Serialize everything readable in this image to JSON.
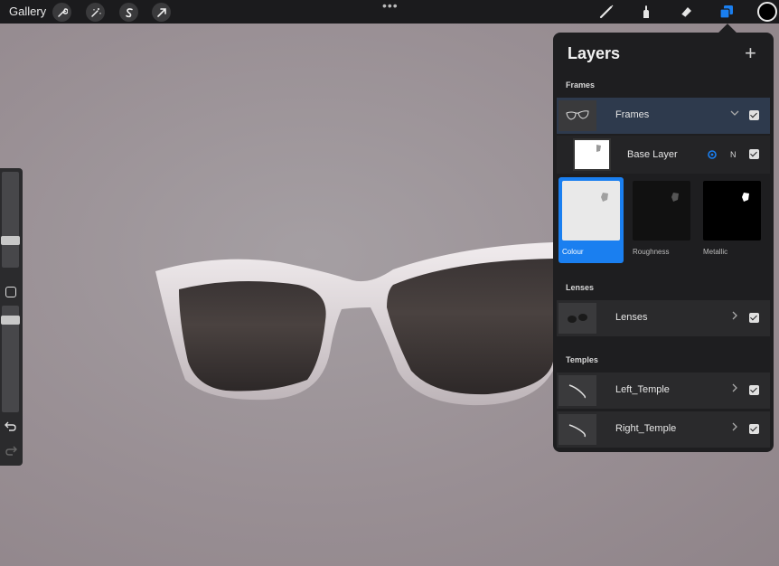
{
  "toolbar": {
    "gallery_label": "Gallery",
    "more_dots": "•••",
    "color_well": "#000000",
    "accent": "#1a7ff0"
  },
  "layers_panel": {
    "title": "Layers",
    "add_symbol": "+",
    "groups": [
      {
        "label": "Frames",
        "layer": {
          "name": "Frames",
          "expanded": true,
          "visible": true
        },
        "base_layer": {
          "name": "Base Layer",
          "blend": "N",
          "visible": true
        },
        "materials": [
          {
            "label": "Colour",
            "selected": true
          },
          {
            "label": "Roughness",
            "selected": false
          },
          {
            "label": "Metallic",
            "selected": false
          }
        ]
      },
      {
        "label": "Lenses",
        "layer": {
          "name": "Lenses",
          "visible": true
        }
      },
      {
        "label": "Temples",
        "layers": [
          {
            "name": "Left_Temple",
            "visible": true
          },
          {
            "name": "Right_Temple",
            "visible": true
          }
        ]
      }
    ]
  }
}
